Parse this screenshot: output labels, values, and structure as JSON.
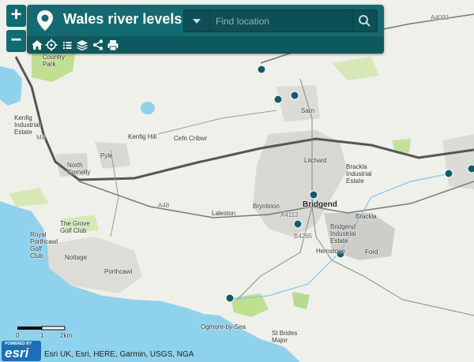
{
  "app": {
    "title": "Wales river levels"
  },
  "search": {
    "placeholder": "Find location"
  },
  "zoom": {
    "in_label": "+",
    "out_label": "−"
  },
  "toolbar": {
    "tools": [
      "home-icon",
      "locate-icon",
      "list-icon",
      "layers-icon",
      "share-icon",
      "print-icon"
    ]
  },
  "map_labels": {
    "country_park": "Country\nPark",
    "kenfig_industrial": "Kenfig\nIndustrial\nEstate",
    "kenfig_hill": "Kenfig Hill",
    "cefn_cribwr": "Cefn Cribwr",
    "sarn": "Sarn",
    "pyle": "Pyle",
    "north_cornelly": "North\nCornelly",
    "litchard": "Litchard",
    "brackla_industrial": "Brackla\nIndustrial\nEstate",
    "bryntirion": "Bryntirion",
    "bridgend": "Bridgend",
    "brackla": "Brackla",
    "laleston": "Laleston",
    "the_grove": "The Grove\nGolf Club",
    "royal_porthcawl": "Royal\nPorthcawl\nGolf\nClub",
    "nottage": "Nottage",
    "bridgend_industrial": "Bridgend\nIndustrial\nEstate",
    "porthcawl": "Porthcawl",
    "hernstone": "Hernstone",
    "ford": "Ford",
    "ogmore": "Ogmore-by-Sea",
    "st_brides": "St Brides\nMajor",
    "a4093": "A4093",
    "a48": "A48",
    "a4113": "A4113",
    "b4265": "B4265",
    "m4": "M4"
  },
  "scale": {
    "zero": "0",
    "one": "1",
    "two": "2km"
  },
  "powered_by": "POWERED BY",
  "esri_logo": "esri",
  "attribution": "Esri UK, Esri, HERE, Garmin, USGS, NGA",
  "colors": {
    "header": "#146a72",
    "marker": "#0d5c6b",
    "water": "#8ed2ee",
    "park": "#bfe08f"
  }
}
